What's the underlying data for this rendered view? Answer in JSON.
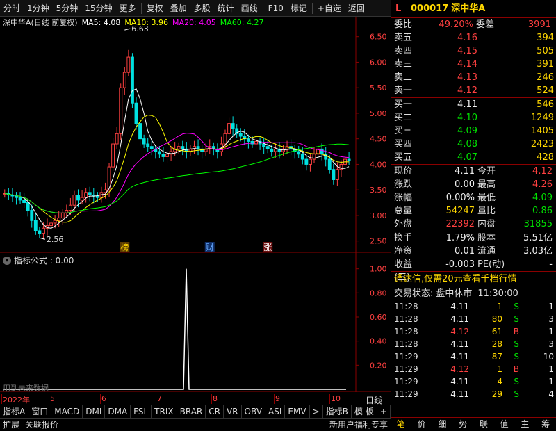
{
  "toolbar": {
    "items": [
      "分时",
      "1分钟",
      "5分钟",
      "15分钟",
      "更多",
      "复权",
      "叠加",
      "多股",
      "统计",
      "画线",
      "F10",
      "标记",
      "+自选",
      "返回"
    ]
  },
  "chart_header": {
    "stock_name": "深中华A(日线 前复权)",
    "ma5": "MA5: 4.08",
    "ma10": "MA10: 3.96",
    "ma20": "MA20: 4.05",
    "ma60": "MA60: 4.27"
  },
  "colors": {
    "up": "#ff4040",
    "down": "#00e000",
    "ma5": "#ffffff",
    "ma10": "#ffff00",
    "ma20": "#ff00ff",
    "ma60": "#00ff00",
    "border": "#8b0000"
  },
  "chart_data": [
    {
      "type": "candlestick",
      "title": "深中华A(日线 前复权)",
      "ylim": [
        2.4,
        6.7
      ],
      "y_ticks": [
        "6.50",
        "6.00",
        "5.50",
        "5.00",
        "4.50",
        "4.00",
        "3.50",
        "3.00",
        "2.50"
      ],
      "annotations": {
        "high": "6.63",
        "low": "2.56"
      },
      "markers": [
        "榜",
        "财",
        "涨"
      ],
      "series": [
        {
          "name": "MA5",
          "value": "4.08"
        },
        {
          "name": "MA10",
          "value": "3.96"
        },
        {
          "name": "MA20",
          "value": "4.05"
        },
        {
          "name": "MA60",
          "value": "4.27"
        }
      ],
      "closes": [
        3.43,
        3.4,
        3.38,
        3.35,
        3.3,
        3.25,
        3.1,
        2.9,
        2.7,
        2.65,
        2.75,
        2.8,
        2.85,
        2.9,
        2.95,
        3.05,
        3.1,
        3.2,
        3.4,
        3.3,
        3.35,
        3.45,
        3.4,
        3.38,
        3.35,
        3.45,
        3.5,
        3.95,
        4.4,
        4.6,
        5.5,
        5.8,
        6.1,
        5.2,
        4.8,
        4.5,
        4.4,
        4.35,
        4.3,
        4.25,
        4.2,
        4.15,
        4.2,
        4.25,
        4.3,
        4.35,
        4.3,
        4.25,
        4.3,
        4.35,
        4.3,
        4.25,
        4.3,
        4.35,
        4.3,
        4.25,
        4.4,
        4.6,
        4.8,
        4.7,
        4.6,
        4.55,
        4.5,
        4.45,
        4.4,
        4.45,
        4.4,
        4.35,
        4.3,
        4.25,
        4.3,
        4.25,
        4.3,
        4.35,
        4.3,
        4.25,
        4.2,
        4.1,
        4.0,
        4.1,
        4.2,
        4.3,
        4.2,
        4.1,
        3.9,
        3.7,
        3.9,
        4.0,
        4.1,
        4.08
      ]
    },
    {
      "type": "line",
      "title": "指标公式 : 0.00",
      "ylim": [
        0,
        1.05
      ],
      "y_ticks": [
        "1.00",
        "0.80",
        "0.60",
        "0.40",
        "0.20"
      ],
      "spike_value": 1.0
    }
  ],
  "sub_header": "指标公式 : 0.00",
  "sub_note": "用到未来数据",
  "time_axis": {
    "labels": [
      "2022年",
      "5",
      "6",
      "7",
      "8",
      "9",
      "10"
    ],
    "right_label": "日线"
  },
  "bottom_tabs": [
    "指标A",
    "窗口",
    "MACD",
    "DMI",
    "DMA",
    "FSL",
    "TRIX",
    "BRAR",
    "CR",
    "VR",
    "OBV",
    "ASI",
    "EMV",
    ">",
    "指标B",
    "模 板",
    "+",
    "−"
  ],
  "status_bar": {
    "left": [
      "扩展",
      "关联报价"
    ],
    "right": "新用户福利专享"
  },
  "panel": {
    "flag": "L",
    "code": "000017",
    "name": "深中华A",
    "weibi_label": "委比",
    "weibi": "49.20%",
    "weicha_label": "委差",
    "weicha": "3991",
    "asks": [
      {
        "label": "卖五",
        "price": "4.16",
        "vol": "394"
      },
      {
        "label": "卖四",
        "price": "4.15",
        "vol": "505"
      },
      {
        "label": "卖三",
        "price": "4.14",
        "vol": "391"
      },
      {
        "label": "卖二",
        "price": "4.13",
        "vol": "246"
      },
      {
        "label": "卖一",
        "price": "4.12",
        "vol": "524"
      }
    ],
    "bids": [
      {
        "label": "买一",
        "price": "4.11",
        "vol": "546",
        "pc": "white"
      },
      {
        "label": "买二",
        "price": "4.10",
        "vol": "1249",
        "pc": "green"
      },
      {
        "label": "买三",
        "price": "4.09",
        "vol": "1405",
        "pc": "green"
      },
      {
        "label": "买四",
        "price": "4.08",
        "vol": "2423",
        "pc": "green"
      },
      {
        "label": "买五",
        "price": "4.07",
        "vol": "428",
        "pc": "green"
      }
    ],
    "stats": [
      {
        "l1": "现价",
        "v1": "4.11",
        "c1": "white",
        "l2": "今开",
        "v2": "4.12",
        "c2": "red"
      },
      {
        "l1": "涨跌",
        "v1": "0.00",
        "c1": "white",
        "l2": "最高",
        "v2": "4.26",
        "c2": "red"
      },
      {
        "l1": "涨幅",
        "v1": "0.00%",
        "c1": "white",
        "l2": "最低",
        "v2": "4.09",
        "c2": "green"
      },
      {
        "l1": "总量",
        "v1": "54247",
        "c1": "yellow",
        "l2": "量比",
        "v2": "0.86",
        "c2": "green"
      },
      {
        "l1": "外盘",
        "v1": "22392",
        "c1": "red",
        "l2": "内盘",
        "v2": "31855",
        "c2": "green"
      }
    ],
    "fund": [
      {
        "l1": "换手",
        "v1": "1.79%",
        "l2": "股本",
        "v2": "5.51亿"
      },
      {
        "l1": "净资",
        "v1": "0.01",
        "l2": "流通",
        "v2": "3.03亿"
      },
      {
        "l1": "收益(三)",
        "v1": "-0.003",
        "l2": "PE(动)",
        "v2": "-"
      }
    ],
    "promo": "通达信,仅需20元查看千档行情",
    "trade_status_label": "交易状态:",
    "trade_status": "盘中休市",
    "trade_time": "11:30:00",
    "ticks": [
      {
        "t": "11:28",
        "p": "4.11",
        "pc": "white",
        "v": "1",
        "s": "S",
        "n": "1"
      },
      {
        "t": "11:28",
        "p": "4.11",
        "pc": "white",
        "v": "80",
        "s": "S",
        "n": "3"
      },
      {
        "t": "11:28",
        "p": "4.12",
        "pc": "red",
        "v": "61",
        "s": "B",
        "n": "1"
      },
      {
        "t": "11:28",
        "p": "4.11",
        "pc": "white",
        "v": "28",
        "s": "S",
        "n": "3"
      },
      {
        "t": "11:29",
        "p": "4.11",
        "pc": "white",
        "v": "87",
        "s": "S",
        "n": "10"
      },
      {
        "t": "11:29",
        "p": "4.12",
        "pc": "red",
        "v": "1",
        "s": "B",
        "n": "1"
      },
      {
        "t": "11:29",
        "p": "4.11",
        "pc": "white",
        "v": "4",
        "s": "S",
        "n": "1"
      },
      {
        "t": "11:29",
        "p": "4.11",
        "pc": "white",
        "v": "29",
        "s": "S",
        "n": "4"
      }
    ],
    "tabs": [
      "笔",
      "价",
      "细",
      "势",
      "联",
      "值",
      "主",
      "筹"
    ]
  }
}
